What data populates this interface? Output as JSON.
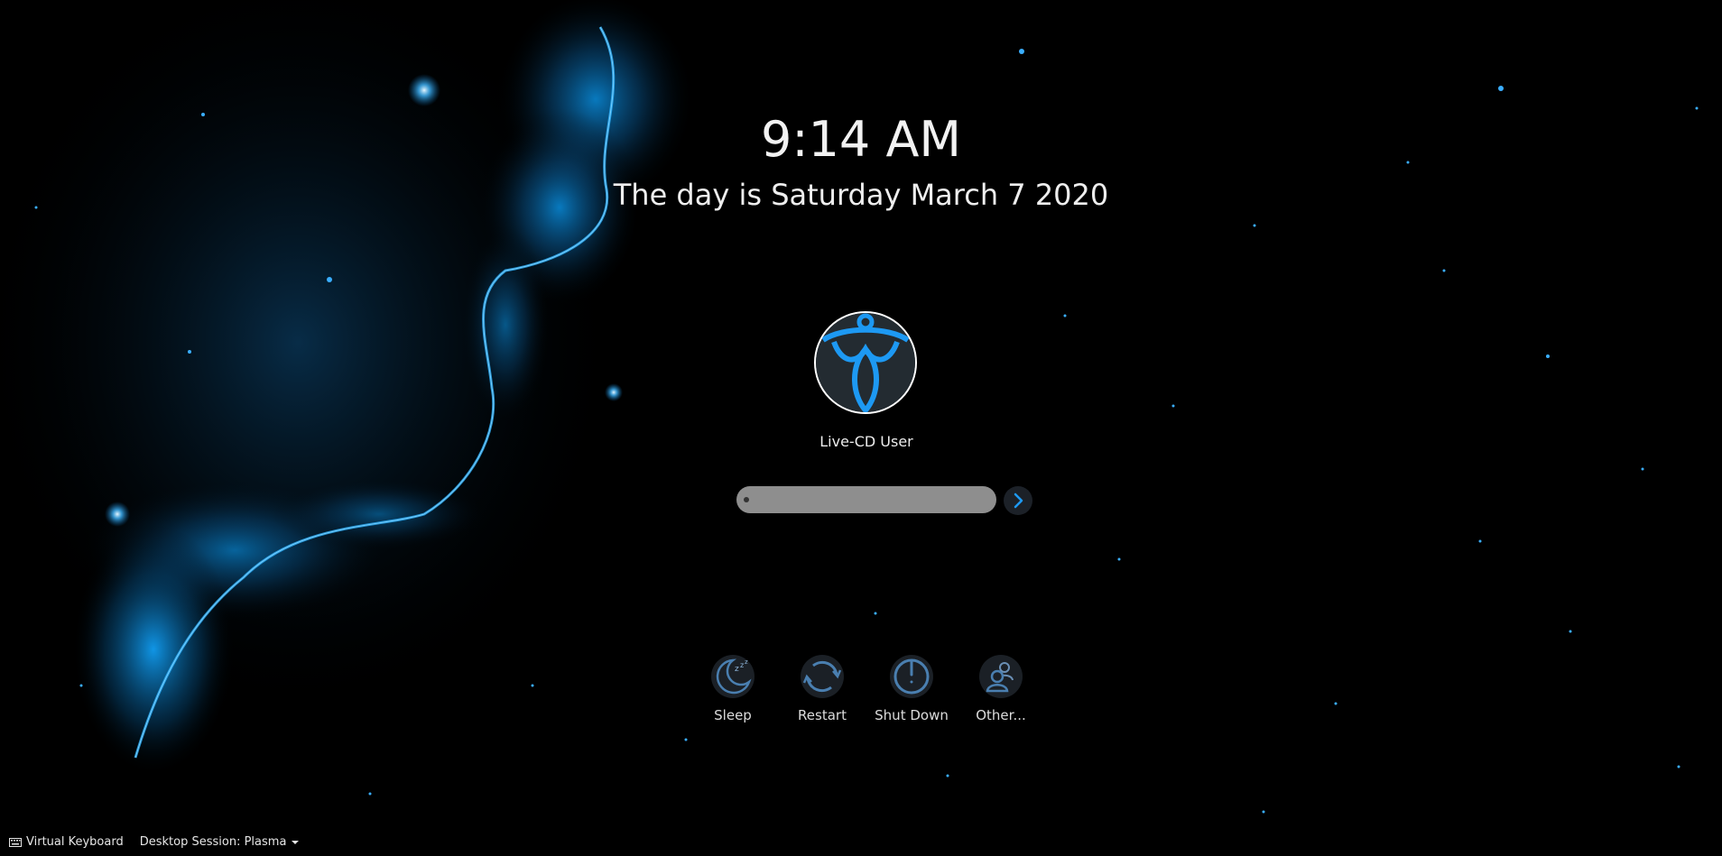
{
  "clock": {
    "time": "9:14 AM",
    "date": "The day is Saturday March 7 2020"
  },
  "user": {
    "name": "Live-CD User"
  },
  "login": {
    "password_value": "",
    "password_placeholder": ""
  },
  "actions": [
    {
      "label": "Sleep",
      "icon": "sleep-icon"
    },
    {
      "label": "Restart",
      "icon": "restart-icon"
    },
    {
      "label": "Shut Down",
      "icon": "power-icon"
    },
    {
      "label": "Other...",
      "icon": "switch-user-icon"
    }
  ],
  "footer": {
    "virtual_keyboard": "Virtual Keyboard",
    "session": "Desktop Session: Plasma"
  },
  "colors": {
    "accent": "#1d99f3",
    "background": "#000000"
  }
}
